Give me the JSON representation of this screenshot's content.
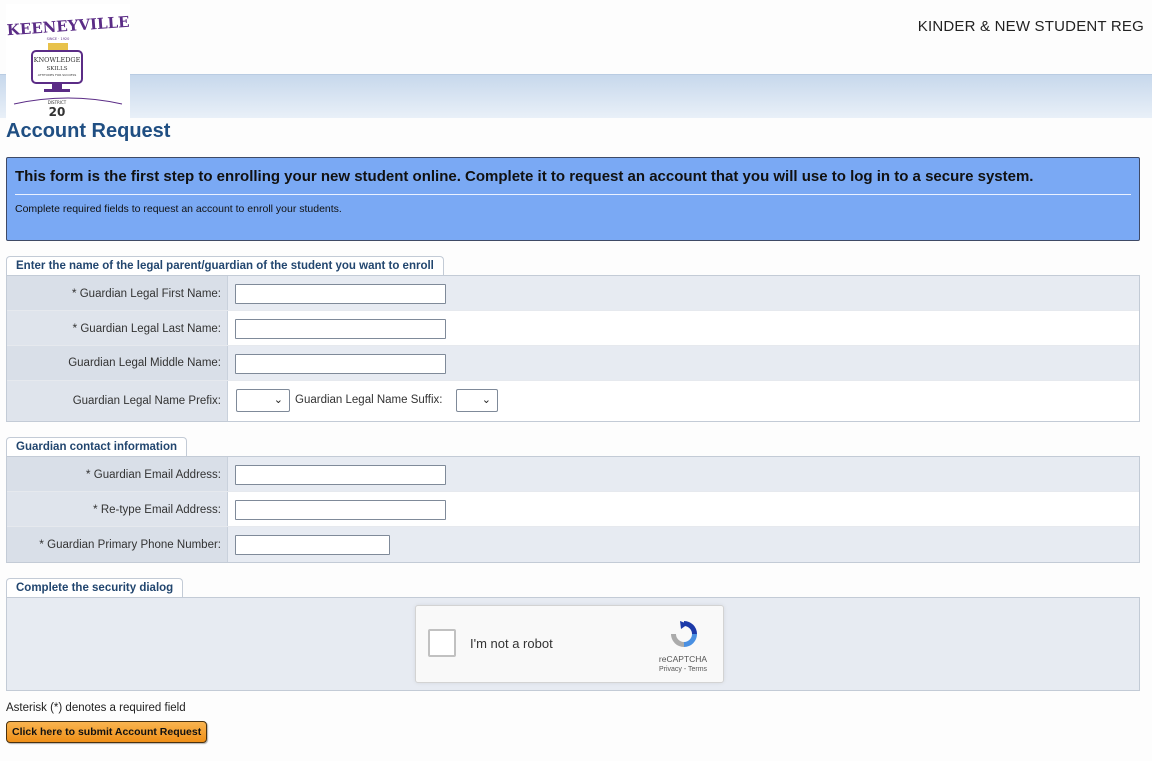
{
  "header": {
    "site_title": "KINDER & NEW STUDENT REG",
    "logo": {
      "school": "KEENEYVILLE",
      "year_text": "SINCE · 1920",
      "line1": "KNOWLEDGE",
      "line2": "SKILLS",
      "line3": "ATTITUDES FOR SUCCESS",
      "district_label": "DISTRICT",
      "district_number": "20"
    }
  },
  "page": {
    "title": "Account Request"
  },
  "banner": {
    "heading": "This form is the first step to enrolling your new student online. Complete it to request an account that you will use to log in to a secure system.",
    "subtext": "Complete required fields to request an account to enroll your students."
  },
  "guardian_section": {
    "tab_label": "Enter the name of the legal parent/guardian of the student you want to enroll",
    "first_name_label": "Guardian Legal First Name:",
    "last_name_label": "Guardian Legal Last Name:",
    "middle_name_label": "Guardian Legal Middle Name:",
    "prefix_label": "Guardian Legal Name Prefix:",
    "suffix_label": "Guardian Legal Name Suffix:",
    "first_name_value": "",
    "last_name_value": "",
    "middle_name_value": "",
    "prefix_selected": "",
    "suffix_selected": ""
  },
  "contact_section": {
    "tab_label": "Guardian contact information",
    "email_label": "Guardian Email Address:",
    "retype_email_label": "Re-type Email Address:",
    "phone_label": "Guardian Primary Phone Number:",
    "email_value": "",
    "retype_email_value": "",
    "phone_value": ""
  },
  "security_section": {
    "tab_label": "Complete the security dialog",
    "recaptcha": {
      "label": "I'm not a robot",
      "brand": "reCAPTCHA",
      "links": "Privacy - Terms"
    }
  },
  "footer": {
    "required_note": "Asterisk (*) denotes a required field",
    "submit_label": "Click here to submit Account Request"
  },
  "required_marker": "*",
  "colors": {
    "banner_bg": "#7aa9f4",
    "title_blue": "#1f4e82",
    "submit_orange": "#ef8f17",
    "logo_purple": "#5b2c86",
    "logo_gold": "#e8c24a"
  }
}
